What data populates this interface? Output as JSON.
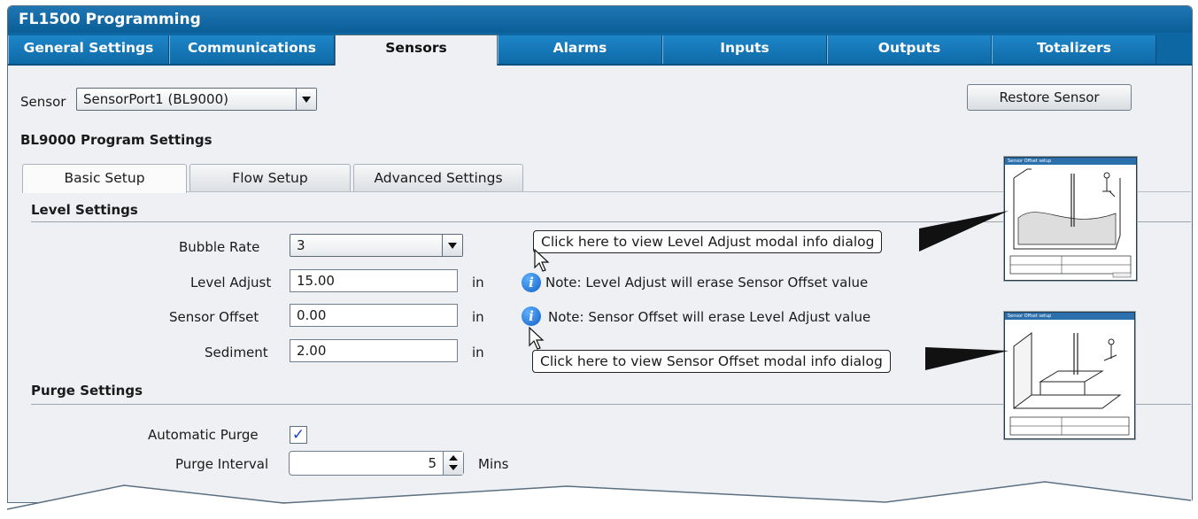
{
  "window": {
    "title": "FL1500 Programming"
  },
  "tabs": [
    {
      "label": "General Settings"
    },
    {
      "label": "Communications"
    },
    {
      "label": "Sensors"
    },
    {
      "label": "Alarms"
    },
    {
      "label": "Inputs"
    },
    {
      "label": "Outputs"
    },
    {
      "label": "Totalizers"
    }
  ],
  "sensor": {
    "label": "Sensor",
    "value": "SensorPort1 (BL9000)",
    "restore_label": "Restore Sensor"
  },
  "program": {
    "heading": "BL9000 Program Settings"
  },
  "subtabs": [
    {
      "label": "Basic Setup"
    },
    {
      "label": "Flow Setup"
    },
    {
      "label": "Advanced Settings"
    }
  ],
  "level": {
    "heading": "Level Settings",
    "bubble_rate": {
      "label": "Bubble Rate",
      "value": "3"
    },
    "level_adjust": {
      "label": "Level Adjust",
      "value": "15.00",
      "unit": "in",
      "note": "Note: Level Adjust will erase Sensor Offset value"
    },
    "sensor_offset": {
      "label": "Sensor Offset",
      "value": "0.00",
      "unit": "in",
      "note": "Note: Sensor Offset will erase Level Adjust value"
    },
    "sediment": {
      "label": "Sediment",
      "value": "2.00",
      "unit": "in"
    }
  },
  "purge": {
    "heading": "Purge Settings",
    "automatic": {
      "label": "Automatic Purge",
      "checked": true,
      "mark": "✓"
    },
    "interval": {
      "label": "Purge Interval",
      "value": "5",
      "unit": "Mins"
    }
  },
  "callouts": {
    "level": "Click here to view Level Adjust modal info dialog",
    "offset": "Click here to view Sensor Offset modal info dialog"
  },
  "info_icon": "i",
  "thumbnails": [
    {
      "title": "Sensor Offset setup"
    },
    {
      "title": "Sensor Offset setup"
    }
  ],
  "colors": {
    "title_bar": "#0b5e97",
    "tab_bar": "#0c67a3",
    "info_icon": "#1a6fd6",
    "check": "#1a3fd0"
  }
}
